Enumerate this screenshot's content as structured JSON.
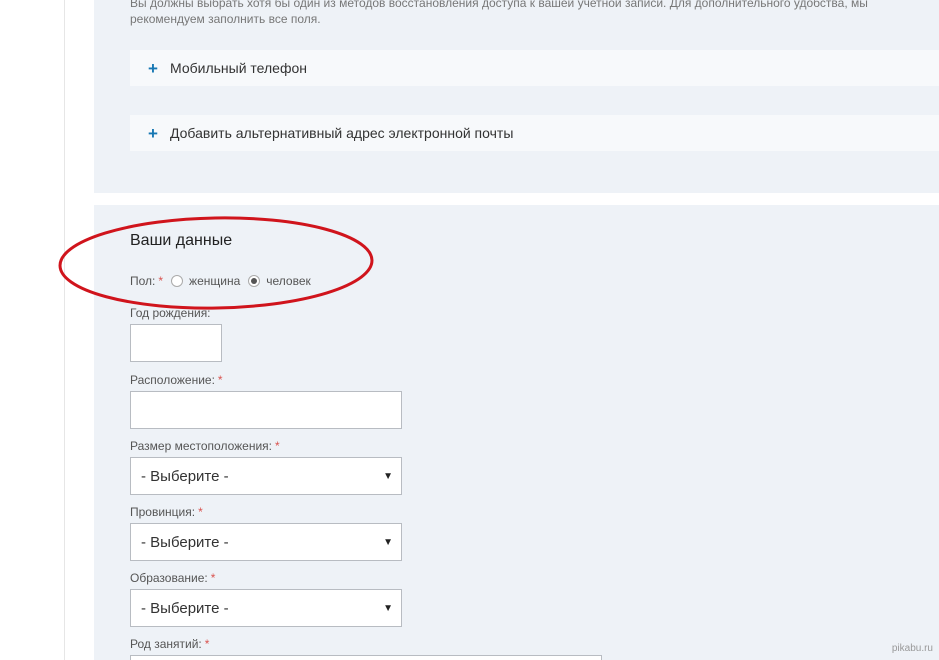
{
  "intro": {
    "text": "Вы должны выбрать хотя бы один из методов восстановления доступа к вашей учетной записи. Для дополнительного удобства, мы рекомендуем заполнить все поля."
  },
  "recovery": {
    "mobile_label": "Мобильный телефон",
    "alt_email_label": "Добавить альтернативный адрес электронной почты",
    "plus_glyph": "+"
  },
  "personal": {
    "title": "Ваши данные",
    "gender_label": "Пол:",
    "required_mark": "*",
    "gender_options": [
      "женщина",
      "человек"
    ],
    "gender_selected": "человек",
    "birth_year_label": "Год рождения:",
    "location_label": "Расположение:",
    "location_size_label": "Размер местоположения:",
    "location_size_value": "- Выберите -",
    "province_label": "Провинция:",
    "province_value": "- Выберите -",
    "education_label": "Образование:",
    "education_value": "- Выберите -",
    "occupation_label": "Род занятий:",
    "arrow_glyph": "▼"
  },
  "watermark": "pikabu.ru",
  "colors": {
    "panel_bg": "#eef2f7",
    "plus_accent": "#1677b3",
    "required": "#d9534f",
    "annotation_ellipse": "#d0141c"
  }
}
